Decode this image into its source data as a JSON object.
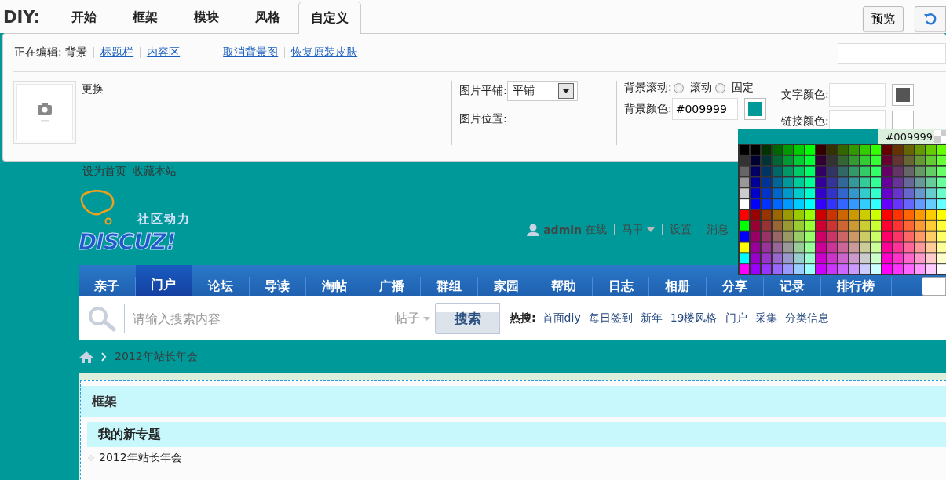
{
  "diy_bar": {
    "label": "DIY:",
    "tabs": [
      {
        "label": "开始",
        "selected": false
      },
      {
        "label": "框架",
        "selected": false
      },
      {
        "label": "模块",
        "selected": false
      },
      {
        "label": "风格",
        "selected": false
      },
      {
        "label": "自定义",
        "selected": true
      }
    ],
    "buttons": [
      {
        "kind": "text",
        "label": "预览"
      },
      {
        "kind": "undo"
      }
    ]
  },
  "editor": {
    "editing_label": "正在编辑:",
    "editing_target": "背景",
    "section_links": [
      "标题栏",
      "内容区"
    ],
    "action_links": [
      "取消背景图",
      "恢复原装皮肤"
    ]
  },
  "background_image": {
    "change_label": "更换",
    "tile_label": "图片平铺:",
    "tile_value": "平铺",
    "position_label": "图片位置:"
  },
  "scroll": {
    "label": "背景滚动:",
    "options": [
      {
        "label": "滚动",
        "selected": false
      },
      {
        "label": "固定",
        "selected": false
      }
    ]
  },
  "bg_color": {
    "label": "背景颜色:",
    "value": "#009999",
    "color": "#009999"
  },
  "text_colors": [
    {
      "label": "文字颜色:",
      "color": "#555555"
    },
    {
      "label": "链接颜色:"
    }
  ],
  "color_picker": {
    "value": "#009999",
    "color": "#009999"
  },
  "site": {
    "top_links": [
      "设为首页",
      "收藏本站"
    ],
    "logo": {
      "tagline": "社区动力",
      "wordmark": "DISCUZ!"
    },
    "user_bar": {
      "username": "admin",
      "status": "在线",
      "links": [
        {
          "label": "马甲",
          "dropdown": true
        },
        {
          "label": "设置",
          "dropdown": false
        },
        {
          "label": "消息",
          "dropdown": false
        }
      ]
    },
    "nav": [
      {
        "label": "亲子",
        "selected": false
      },
      {
        "label": "门户",
        "selected": true
      },
      {
        "label": "论坛",
        "selected": false
      },
      {
        "label": "导读",
        "selected": false
      },
      {
        "label": "淘帖",
        "selected": false
      },
      {
        "label": "广播",
        "selected": false
      },
      {
        "label": "群组",
        "selected": false
      },
      {
        "label": "家园",
        "selected": false
      },
      {
        "label": "帮助",
        "selected": false
      },
      {
        "label": "日志",
        "selected": false
      },
      {
        "label": "相册",
        "selected": false
      },
      {
        "label": "分享",
        "selected": false
      },
      {
        "label": "记录",
        "selected": false
      },
      {
        "label": "排行榜",
        "selected": false
      }
    ],
    "search": {
      "placeholder": "请输入搜索内容",
      "type": "帖子",
      "button": "搜索",
      "hot_label": "热搜:",
      "hot_links": [
        "首面diy",
        "每日签到",
        "新年",
        "19楼风格",
        "门户",
        "采集",
        "分类信息"
      ]
    },
    "breadcrumb": [
      "2012年站长年会"
    ],
    "frame": {
      "title": "框架",
      "block_title": "我的新专题",
      "items": [
        "2012年站长年会"
      ]
    }
  }
}
